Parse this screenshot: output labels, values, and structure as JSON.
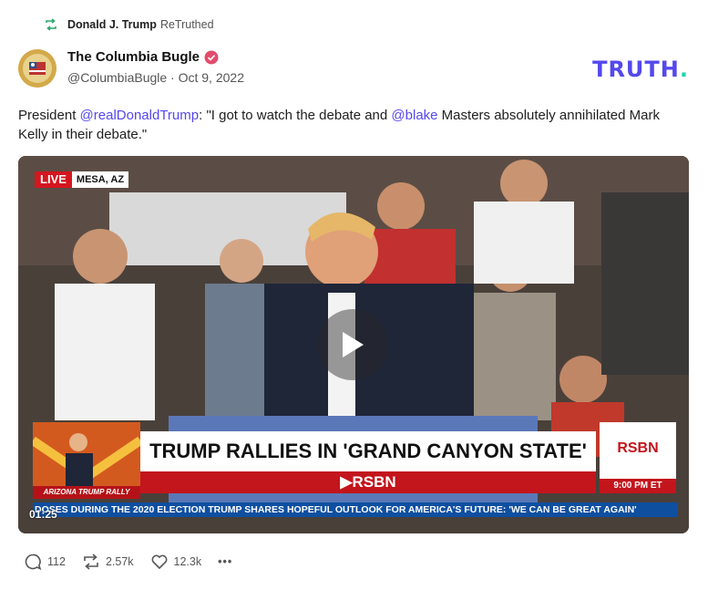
{
  "retruth": {
    "user": "Donald J. Trump",
    "action": "ReTruthed",
    "icon": "retruth-icon"
  },
  "post": {
    "author_name": "The Columbia Bugle",
    "verified_icon": "verified-badge-icon",
    "handle_date": "@ColumbiaBugle · Oct 9, 2022",
    "text_parts": {
      "p1": "President ",
      "m1": "@realDonaldTrump",
      "p2": ": \"I got to watch the debate and ",
      "m2": "@blake",
      "p3": " Masters absolutely annihilated Mark Kelly in their debate.\""
    }
  },
  "brand": {
    "text": "TRUTH",
    "dot": ".",
    "color": "#5448ee",
    "dot_color": "#1fd3b0"
  },
  "video": {
    "live_label": "LIVE",
    "location": "MESA, AZ",
    "headline": "TRUMP RALLIES IN 'GRAND CANYON STATE'",
    "subline": "▶RSBN",
    "thumb_caption": "ARIZONA TRUMP RALLY",
    "logo": "RSBN",
    "time": "9:00 PM ET",
    "ticker": "DOSES DURING THE 2020 ELECTION    TRUMP SHARES HOPEFUL OUTLOOK FOR AMERICA'S FUTURE: 'WE CAN BE GREAT AGAIN'",
    "duration": "01:25",
    "play_icon": "play-icon"
  },
  "actions": {
    "replies": "112",
    "retruths": "2.57k",
    "likes": "12.3k",
    "more": "•••"
  }
}
